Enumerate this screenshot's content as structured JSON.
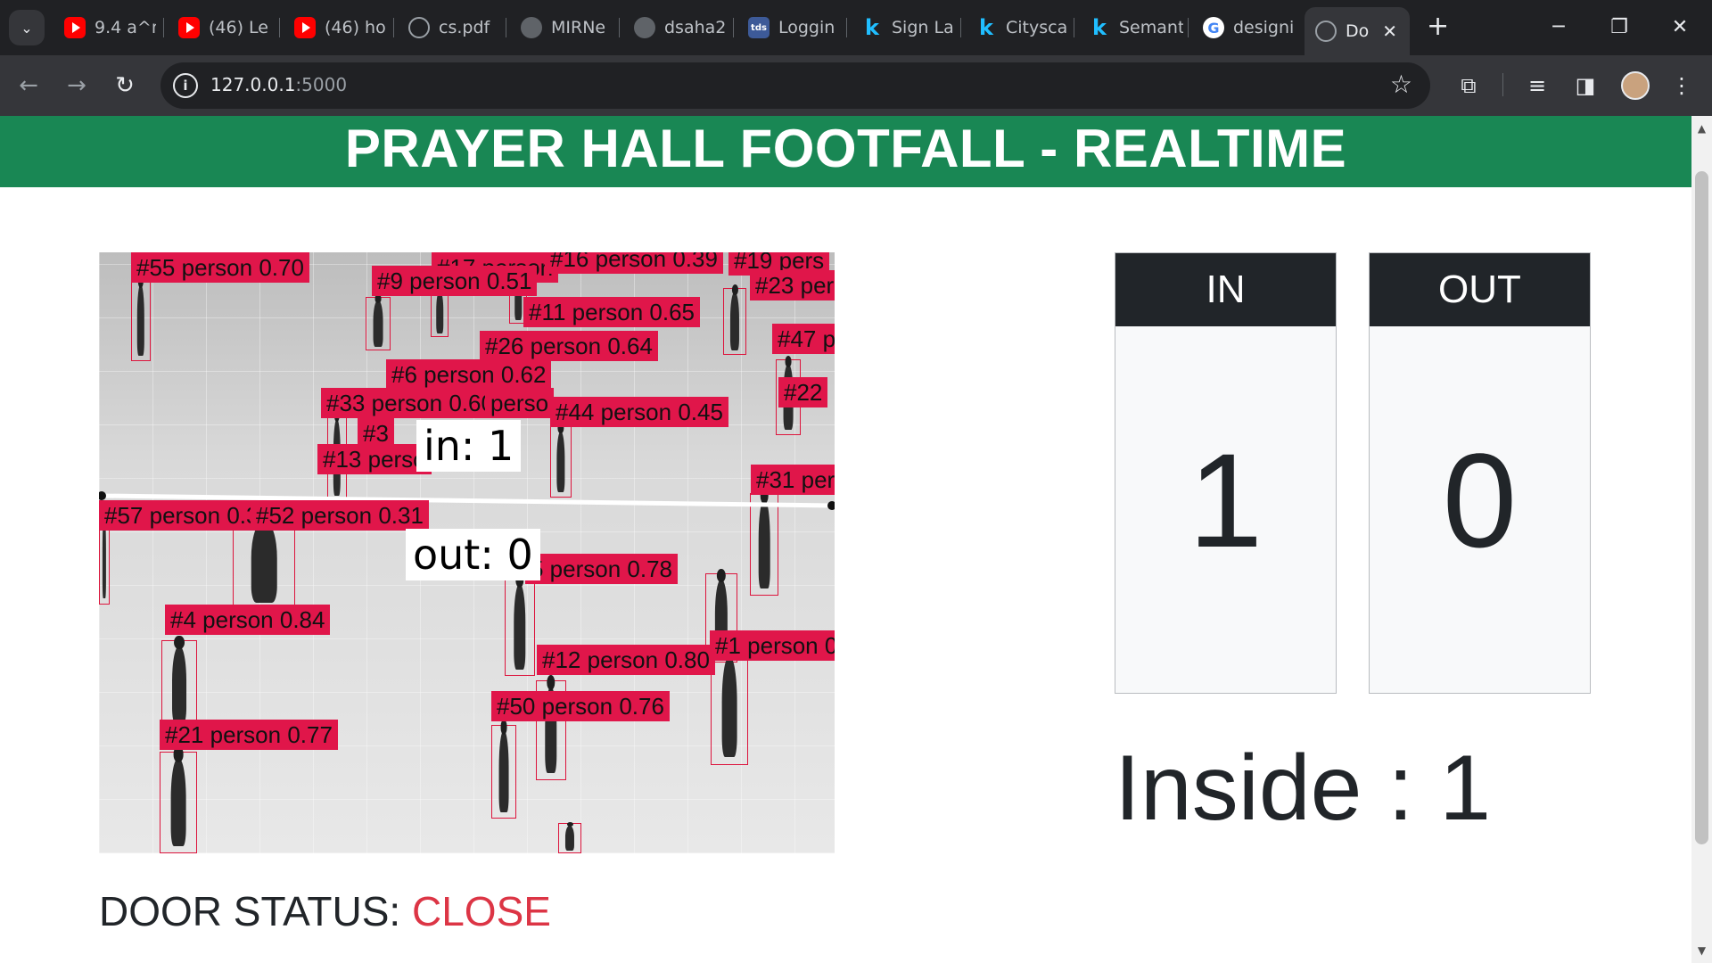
{
  "browser": {
    "tabs": [
      {
        "title": "9.4 a^n",
        "icon": "youtube-icon"
      },
      {
        "title": "(46) Le",
        "icon": "youtube-icon"
      },
      {
        "title": "(46) ho",
        "icon": "youtube-icon"
      },
      {
        "title": "cs.pdf",
        "icon": "globe-icon"
      },
      {
        "title": "MIRNe",
        "icon": "github-icon"
      },
      {
        "title": "dsaha2",
        "icon": "github-icon"
      },
      {
        "title": "Loggin",
        "icon": "tds-icon"
      },
      {
        "title": "Sign La",
        "icon": "kaggle-icon"
      },
      {
        "title": "Citysca",
        "icon": "kaggle-icon"
      },
      {
        "title": "Semant",
        "icon": "kaggle-icon"
      },
      {
        "title": "designi",
        "icon": "google-icon"
      },
      {
        "title": "Do",
        "icon": "globe-icon",
        "active": true
      }
    ],
    "tds_favicon_text": "tds",
    "kaggle_favicon_text": "k",
    "google_favicon_text": "G",
    "url_host": "127.0.0.1",
    "url_port": ":5000"
  },
  "page": {
    "title": "PRAYER HALL FOOTFALL - REALTIME",
    "accent_color": "#198754",
    "counters": {
      "in_label": "IN",
      "in_value": "1",
      "out_label": "OUT",
      "out_value": "0"
    },
    "inside_text": "Inside : 1",
    "door_label": "DOOR STATUS: ",
    "door_state": "CLOSE",
    "door_state_color": "#dc3545"
  },
  "video_feed": {
    "overlay_in": "in: 1",
    "overlay_out": "out: 0",
    "label_color": "#e0164a",
    "detections": [
      "#55 person 0.70",
      "#17 person",
      "#16 person 0.39",
      "#19 pers",
      "#9 person 0.51",
      "#23 pers",
      "#11 person 0.65",
      "#47 p",
      "#26 person 0.64",
      "#6 person 0.62",
      "#22",
      "#33 person 0.60",
      "perso",
      "#44 person 0.45",
      "#3",
      "#13 perso",
      "#31 pers",
      "#57 person 0.3",
      "#52 person 0.31",
      "5 person 0.78",
      "#4 person 0.84",
      "#1 person 0.",
      "#12 person 0.80",
      "#50 person 0.76",
      "#21 person 0.77"
    ]
  }
}
